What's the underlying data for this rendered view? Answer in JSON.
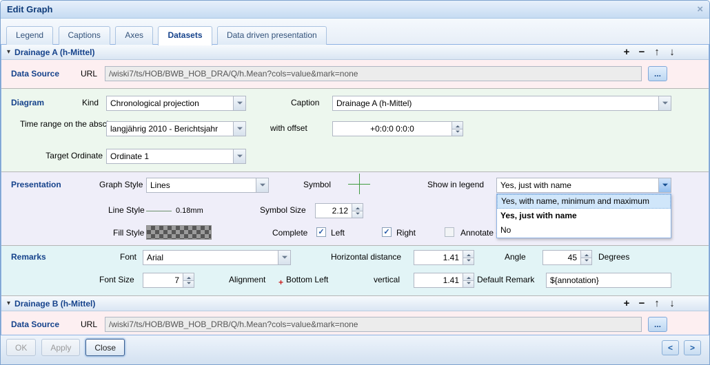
{
  "window": {
    "title": "Edit Graph"
  },
  "icons": {
    "close": "×",
    "collapse": "▾",
    "add": "+",
    "remove": "−",
    "up": "↑",
    "down": "↓",
    "check": "✓",
    "ellipsis": "...",
    "prev": "<",
    "next": ">",
    "anchor": "+"
  },
  "tabs": [
    "Legend",
    "Captions",
    "Axes",
    "Datasets",
    "Data driven presentation"
  ],
  "panel_a": {
    "title": "Drainage A (h-Mittel)",
    "data_source": {
      "label": "Data Source",
      "url_label": "URL",
      "url": "/wiski7/ts/HOB/BWB_HOB_DRA/Q/h.Mean?cols=value&mark=none"
    },
    "diagram": {
      "label": "Diagram",
      "kind_label": "Kind",
      "kind": "Chronological projection",
      "caption_label": "Caption",
      "caption": "Drainage A (h-Mittel)",
      "time_range_label": "Time range on the abscissa",
      "time_range": "langjährig 2010 - Berichtsjahr",
      "offset_label": "with offset",
      "offset": "+0:0:0 0:0:0",
      "ordinate_label": "Target Ordinate",
      "ordinate": "Ordinate 1"
    },
    "presentation": {
      "label": "Presentation",
      "graph_style_label": "Graph Style",
      "graph_style": "Lines",
      "symbol_label": "Symbol",
      "legend_label": "Show in legend",
      "legend": "Yes, just with name",
      "options": [
        "Yes, with name, minimum and maximum",
        "Yes, just with name",
        "No"
      ],
      "line_style_label": "Line Style",
      "line_width": "0.18mm",
      "symbol_size_label": "Symbol Size",
      "symbol_size": "2.12",
      "fill_style_label": "Fill Style",
      "complete_label": "Complete",
      "left_label": "Left",
      "right_label": "Right",
      "annotate_label": "Annotate e"
    },
    "remarks": {
      "label": "Remarks",
      "font_label": "Font",
      "font": "Arial",
      "hdist_label": "Horizontal distance",
      "hdist": "1.41",
      "angle_label": "Angle",
      "angle": "45",
      "degrees_label": "Degrees",
      "font_size_label": "Font Size",
      "font_size": "7",
      "alignment_label": "Alignment",
      "alignment": "Bottom Left",
      "vertical_label": "vertical",
      "vdist": "1.41",
      "default_remark_label": "Default Remark",
      "default_remark": "${annotation}"
    }
  },
  "panel_b": {
    "title": "Drainage B (h-Mittel)",
    "data_source": {
      "label": "Data Source",
      "url_label": "URL",
      "url": "/wiski7/ts/HOB/BWB_HOB_DRB/Q/h.Mean?cols=value&mark=none"
    }
  },
  "footer": {
    "ok": "OK",
    "apply": "Apply",
    "close": "Close"
  }
}
